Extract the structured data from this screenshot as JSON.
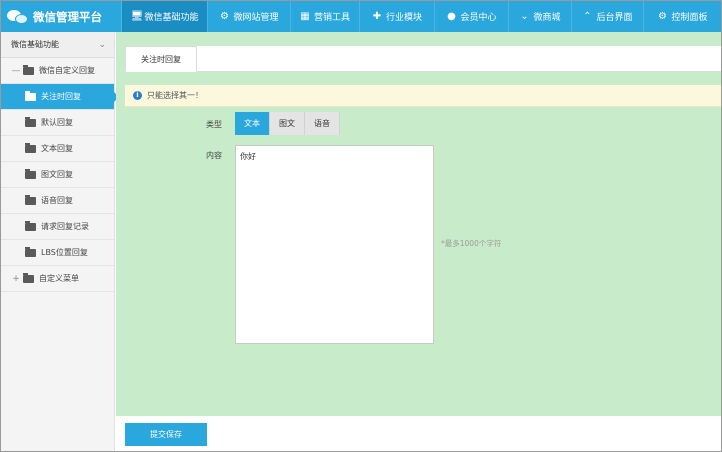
{
  "app": {
    "title": "微信管理平台"
  },
  "nav": [
    {
      "label": "微信基础功能",
      "icon": "monitor-icon",
      "active": true
    },
    {
      "label": "微网站管理",
      "icon": "gear-icon"
    },
    {
      "label": "营销工具",
      "icon": "gift-icon"
    },
    {
      "label": "行业模块",
      "icon": "puzzle-icon"
    },
    {
      "label": "会员中心",
      "icon": "user-icon"
    },
    {
      "label": "微商城",
      "icon": "chevron-down-icon"
    },
    {
      "label": "后台界面",
      "icon": "chevron-up-icon"
    },
    {
      "label": "控制面板",
      "icon": "gear-icon"
    }
  ],
  "sidebar": {
    "header": "微信基础功能",
    "group1": "微信自定义回复",
    "items": [
      {
        "label": "关注时回复",
        "active": true
      },
      {
        "label": "默认回复"
      },
      {
        "label": "文本回复"
      },
      {
        "label": "图文回复"
      },
      {
        "label": "语音回复"
      },
      {
        "label": "请求回复记录"
      },
      {
        "label": "LBS位置回复"
      }
    ],
    "group2": "自定义菜单"
  },
  "main": {
    "tab": "关注时回复",
    "notice": "只能选择其一！",
    "type_label": "类型",
    "types": [
      "文本",
      "图文",
      "语音"
    ],
    "selected_type": "文本",
    "content_label": "内容",
    "content_value": "你好",
    "hint": "*最多1000个字符",
    "submit": "提交保存"
  },
  "colors": {
    "accent": "#2aa7dc",
    "main_bg": "#c8ecca",
    "notice_bg": "#fbf8dd"
  }
}
